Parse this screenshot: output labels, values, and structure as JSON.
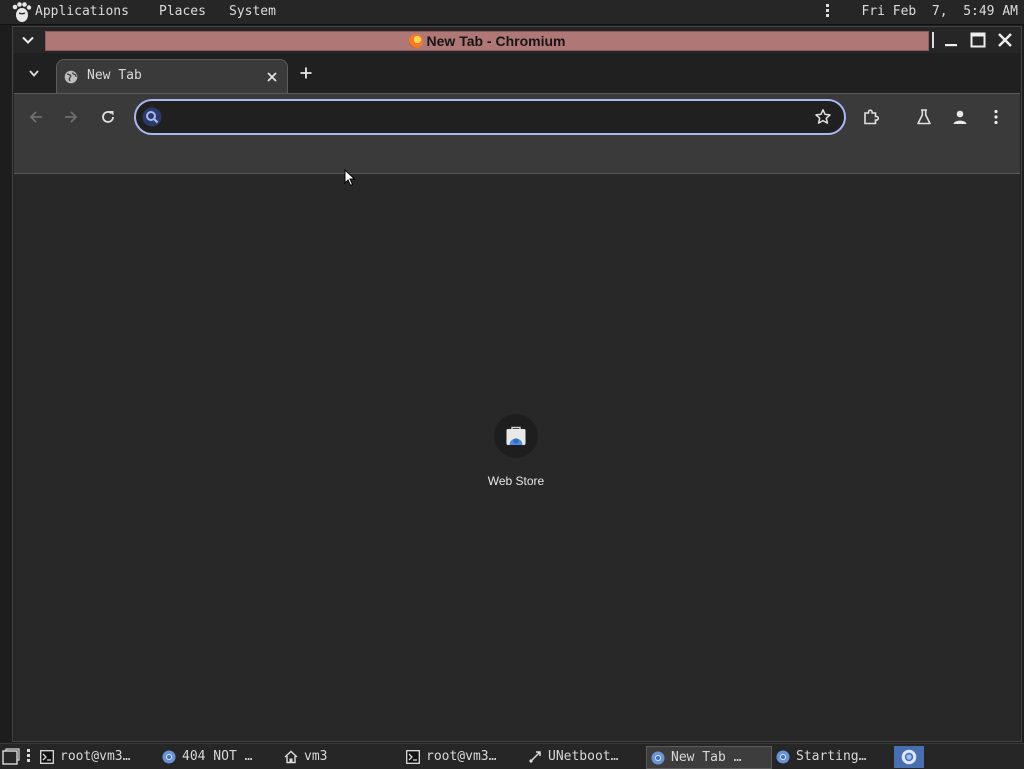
{
  "top_panel": {
    "menus": [
      "Applications",
      "Places",
      "System"
    ],
    "clock": "Fri Feb  7,  5:49 AM"
  },
  "window": {
    "title": "New Tab - Chromium"
  },
  "browser": {
    "tabs": [
      {
        "title": "New Tab",
        "icon": "globe-icon",
        "active": true
      }
    ],
    "omnibox": {
      "value": "",
      "placeholder": ""
    },
    "shortcuts": [
      {
        "label": "Web Store",
        "icon": "web-store-icon"
      }
    ]
  },
  "taskbar": {
    "items": [
      {
        "label": "root@vm3…",
        "icon": "terminal-icon"
      },
      {
        "label": "404 NOT …",
        "icon": "chromium-icon"
      },
      {
        "label": "vm3",
        "icon": "home-folder-icon"
      },
      {
        "label": "root@vm3…",
        "icon": "terminal-icon"
      },
      {
        "label": "UNetboot…",
        "icon": "unetbootin-icon"
      },
      {
        "label": "New Tab …",
        "icon": "chromium-icon",
        "active": true
      },
      {
        "label": "Starting…",
        "icon": "chromium-icon"
      }
    ]
  },
  "colors": {
    "title_strip": "#b07777",
    "omnibox_focus": "#a9b8f3",
    "tab_bg": "#3a3a3a",
    "ntp_bg": "#282828",
    "tray_highlight": "#4a6fb0"
  }
}
